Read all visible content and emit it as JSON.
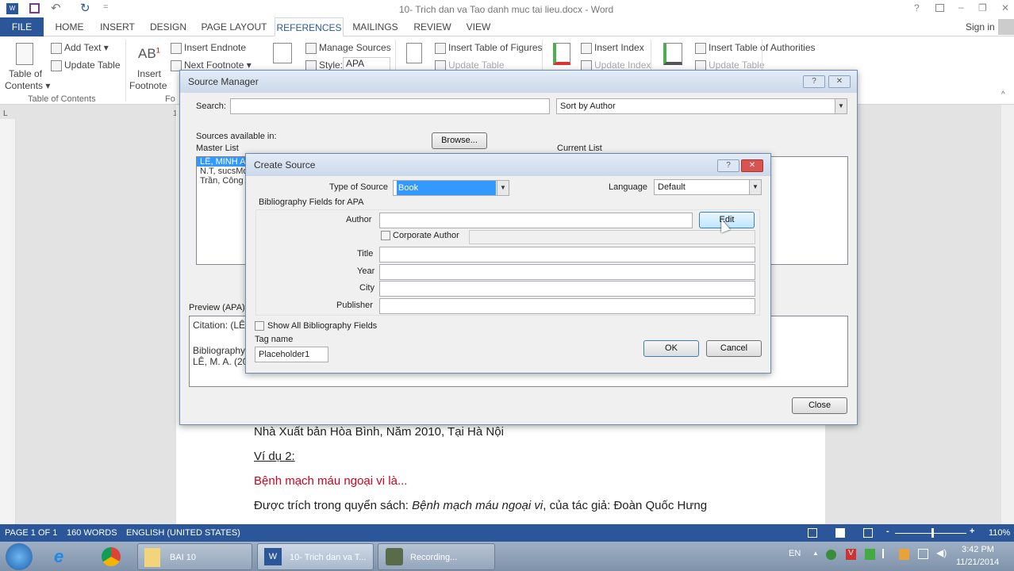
{
  "window": {
    "title": "10- Trich dan va Tao danh muc tai lieu.docx - Word",
    "sign_in": "Sign in",
    "help": "?",
    "minimize": "–",
    "restore": "❐",
    "close": "✕"
  },
  "quick_access": {
    "undo": "↶",
    "redo": "↻",
    "customize": "="
  },
  "tabs": [
    "FILE",
    "HOME",
    "INSERT",
    "DESIGN",
    "PAGE LAYOUT",
    "REFERENCES",
    "MAILINGS",
    "REVIEW",
    "VIEW"
  ],
  "active_tab": "REFERENCES",
  "ribbon": {
    "toc": {
      "button": "Table of",
      "button2": "Contents ▾",
      "add_text": "Add Text ▾",
      "update_table": "Update Table",
      "group": "Table of Contents"
    },
    "footnotes": {
      "insert_footnote": "Insert",
      "insert_footnote2": "Footnote",
      "insert_endnote": "Insert Endnote",
      "next_footnote": "Next Footnote ▾",
      "group": "Fo"
    },
    "citations": {
      "manage_sources": "Manage Sources",
      "style_label": "Style:",
      "style_value": "APA"
    },
    "captions": {
      "insert_table_of_figures": "Insert Table of Figures",
      "update_table": "Update Table"
    },
    "index": {
      "insert_index": "Insert Index",
      "update_index": "Update Index"
    },
    "authorities": {
      "insert_table_of_authorities": "Insert Table of Authorities",
      "update_table": "Update Table"
    }
  },
  "ruler": {
    "mark": "1"
  },
  "document": {
    "lines": [
      "Nhà Xuất bản Hòa Bình, Năm 2010, Tại Hà Nội",
      "Ví dụ 2:",
      "Bệnh mạch máu ngoại vi là...",
      "Được trích trong quyển sách: ",
      "Bệnh mạch máu ngoại vi",
      ", của tác giả: Đoàn Quốc Hưng"
    ],
    "heading_color": "#d0021b"
  },
  "source_manager": {
    "title": "Source Manager",
    "help": "?",
    "close_x": "✕",
    "search_label": "Search:",
    "search_value": "",
    "sort_value": "Sort by Author",
    "sources_available": "Sources available in:",
    "master_list": "Master List",
    "browse": "Browse...",
    "current_list": "Current List",
    "master_items": [
      "LÊ, MINH AN",
      "N.T, sucsMo",
      "Trần, Công"
    ],
    "preview_label": "Preview (APA):",
    "preview_lines": [
      "Citation: (LÊ",
      "Bibliography",
      "LÊ, M. A. (20"
    ],
    "close": "Close"
  },
  "create_source": {
    "title": "Create Source",
    "help": "?",
    "close_x": "✕",
    "type_label": "Type of Source",
    "type_value": "Book",
    "language_label": "Language",
    "language_value": "Default",
    "fields_header": "Bibliography Fields for APA",
    "fields": [
      {
        "label": "Author",
        "value": ""
      },
      {
        "label": "Title",
        "value": ""
      },
      {
        "label": "Year",
        "value": ""
      },
      {
        "label": "City",
        "value": ""
      },
      {
        "label": "Publisher",
        "value": ""
      }
    ],
    "edit": "Edit",
    "corporate_author": "Corporate Author",
    "corporate_checked": false,
    "show_all": "Show All Bibliography Fields",
    "show_all_checked": false,
    "tag_label": "Tag name",
    "tag_value": "Placeholder1",
    "ok": "OK",
    "cancel": "Cancel"
  },
  "status": {
    "page": "PAGE 1 OF 1",
    "words": "160 WORDS",
    "language": "ENGLISH (UNITED STATES)",
    "zoom": "110%",
    "zoom_percent": 110
  },
  "taskbar": {
    "items": [
      "BAI 10",
      "10- Trich dan va T...",
      "Recording..."
    ],
    "lang": "EN",
    "time": "3:42 PM",
    "date": "11/21/2014"
  }
}
